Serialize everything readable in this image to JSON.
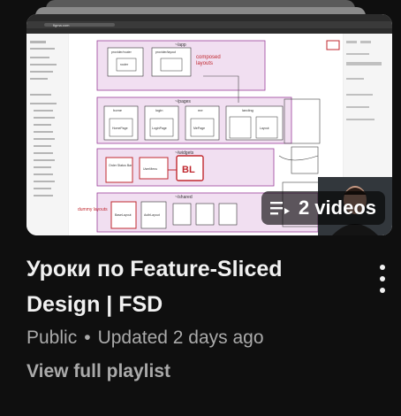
{
  "playlist": {
    "title": "Уроки по Feature-Sliced Design | FSD",
    "video_count": "2 videos",
    "visibility": "Public",
    "separator": "•",
    "updated": "Updated 2 days ago",
    "view_link": "View full playlist",
    "more_icon": "more-vert-icon",
    "playlist_icon": "playlist-icon"
  },
  "thumbnail": {
    "url_text": "figma.com",
    "labels": {
      "app": "~/app",
      "pages": "~/pages",
      "widgets": "~/widgets",
      "shared": "~/shared",
      "composed": "composed",
      "layouts": "layouts",
      "router": "router",
      "provider_router": "provider/router",
      "provider_layout": "provider/layout",
      "home": "home",
      "login": "login",
      "me": "me",
      "landing": "landing",
      "home_page": "HomePage",
      "login_page": "LoginPage",
      "me_page": "MePage",
      "landing_page": "Landing Page",
      "layout": "Layout",
      "order_status_bar": "Order Status Bar",
      "user_menu": "UserMenu",
      "bl": "BL",
      "base_layout": "BaseLayout",
      "auth_layout": "AuthLayout",
      "dummy_layouts": "dummy layouts",
      "ui": "ui"
    }
  },
  "colors": {
    "accent_red": "#c0282f",
    "frame_purple": "#9b3f9b",
    "badge_bg": "rgba(0,0,0,0.62)"
  }
}
